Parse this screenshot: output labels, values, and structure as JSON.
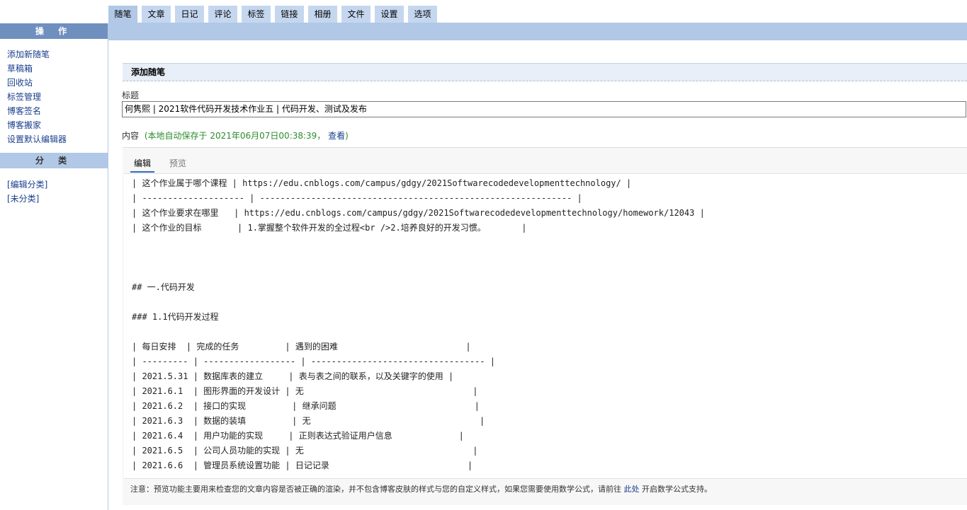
{
  "tabs": [
    {
      "label": "随笔",
      "active": true
    },
    {
      "label": "文章"
    },
    {
      "label": "日记"
    },
    {
      "label": "评论"
    },
    {
      "label": "标签"
    },
    {
      "label": "链接"
    },
    {
      "label": "相册"
    },
    {
      "label": "文件"
    },
    {
      "label": "设置"
    },
    {
      "label": "选项"
    }
  ],
  "sidebar": {
    "ops_header": "操 作",
    "ops_links": [
      "添加新随笔",
      "草稿箱",
      "回收站",
      "标签管理",
      "博客签名",
      "博客搬家",
      "设置默认编辑器"
    ],
    "cat_header": "分 类",
    "cat_links": [
      "[编辑分类]",
      "[未分类]"
    ]
  },
  "main": {
    "section_title": "添加随笔",
    "title_label": "标题",
    "title_value": "何隽熙 | 2021软件代码开发技术作业五 | 代码开发、测试及发布",
    "content_label": "内容",
    "autosave_text": "(本地自动保存于 2021年06月07日00:38:39，",
    "autosave_link": "查看",
    "autosave_close": ")"
  },
  "editor": {
    "tabs": [
      "编辑",
      "预览"
    ],
    "content": "| 这个作业属于哪个课程 | https://edu.cnblogs.com/campus/gdgy/2021Softwarecodedevelopmenttechnology/ |\n| -------------------- | ------------------------------------------------------------- |\n| 这个作业要求在哪里   | https://edu.cnblogs.com/campus/gdgy/2021Softwarecodedevelopmenttechnology/homework/12043 |\n| 这个作业的目标       | 1.掌握整个软件开发的全过程<br />2.培养良好的开发习惯。       |\n\n\n\n## 一.代码开发\n\n### 1.1代码开发过程\n\n| 每日安排  | 完成的任务         | 遇到的困难                         |\n| --------- | ------------------ | ---------------------------------- |\n| 2021.5.31 | 数据库表的建立     | 表与表之间的联系，以及关键字的使用 |\n| 2021.6.1  | 图形界面的开发设计 | 无                                 |\n| 2021.6.2  | 接口的实现         | 继承问题                           |\n| 2021.6.3  | 数据的装填         | 无                                 |\n| 2021.6.4  | 用户功能的实现     | 正则表达式验证用户信息             |\n| 2021.6.5  | 公司人员功能的实现 | 无                                 |\n| 2021.6.6  | 管理员系统设置功能 | 日记记录                           |",
    "note_text": "注意：预览功能主要用来检查您的文章内容是否被正确的渲染，并不包含博客皮肤的样式与您的自定义样式，如果您需要使用数学公式，请前往",
    "note_link": "此处",
    "note_tail": "开启数学公式支持。"
  }
}
